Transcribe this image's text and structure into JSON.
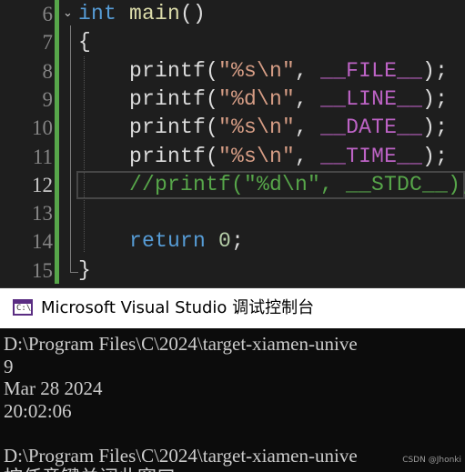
{
  "editor": {
    "lines": [
      {
        "num": "6",
        "parts": [
          [
            "kw",
            "int"
          ],
          [
            "plain",
            " "
          ],
          [
            "fn",
            "main"
          ],
          [
            "plain",
            "()"
          ]
        ]
      },
      {
        "num": "7",
        "parts": [
          [
            "plain",
            "{"
          ]
        ]
      },
      {
        "num": "8",
        "parts": [
          [
            "plain",
            "    printf("
          ],
          [
            "str",
            "\"%s\\n\""
          ],
          [
            "plain",
            ", "
          ],
          [
            "macro",
            "__FILE__"
          ],
          [
            "plain",
            ");"
          ]
        ]
      },
      {
        "num": "9",
        "parts": [
          [
            "plain",
            "    printf("
          ],
          [
            "str",
            "\"%d\\n\""
          ],
          [
            "plain",
            ", "
          ],
          [
            "macro",
            "__LINE__"
          ],
          [
            "plain",
            ");"
          ]
        ]
      },
      {
        "num": "10",
        "parts": [
          [
            "plain",
            "    printf("
          ],
          [
            "str",
            "\"%s\\n\""
          ],
          [
            "plain",
            ", "
          ],
          [
            "macro",
            "__DATE__"
          ],
          [
            "plain",
            ");"
          ]
        ]
      },
      {
        "num": "11",
        "parts": [
          [
            "plain",
            "    printf("
          ],
          [
            "str",
            "\"%s\\n\""
          ],
          [
            "plain",
            ", "
          ],
          [
            "macro",
            "__TIME__"
          ],
          [
            "plain",
            ");"
          ]
        ]
      },
      {
        "num": "12",
        "parts": [
          [
            "cmt",
            "    //printf(\"%d\\n\", __STDC__);"
          ]
        ]
      },
      {
        "num": "13",
        "parts": [
          [
            "plain",
            ""
          ]
        ]
      },
      {
        "num": "14",
        "parts": [
          [
            "kw",
            "    return"
          ],
          [
            "plain",
            " "
          ],
          [
            "num",
            "0"
          ],
          [
            "plain",
            ";"
          ]
        ]
      },
      {
        "num": "15",
        "parts": [
          [
            "plain",
            "}"
          ]
        ]
      }
    ],
    "current_line": "12"
  },
  "console": {
    "title": "Microsoft Visual Studio 调试控制台",
    "icon": "console-app-icon",
    "prompt_glyph": "C:\\",
    "output": [
      "D:\\Program Files\\C\\2024\\target-xiamen-unive",
      "9",
      "Mar 28 2024",
      "20:02:06",
      "",
      "D:\\Program Files\\C\\2024\\target-xiamen-unive",
      "按任意键关闭此窗口..."
    ]
  },
  "watermark": "CSDN @Jhonki"
}
